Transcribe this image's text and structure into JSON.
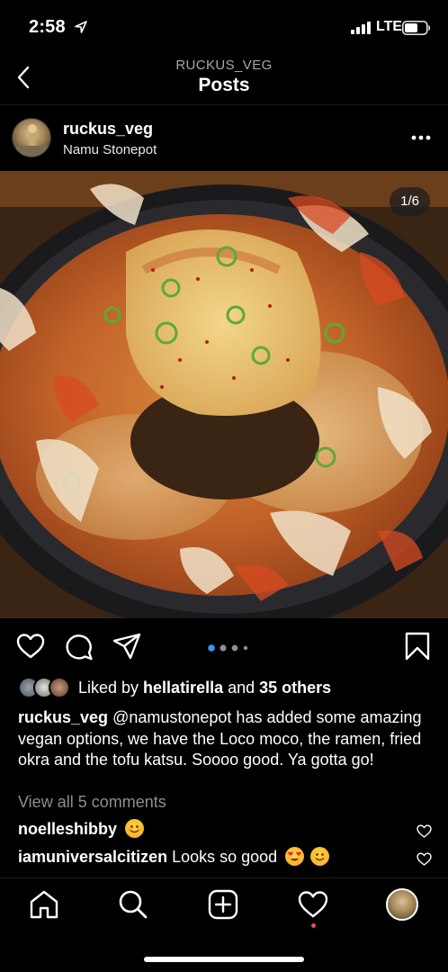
{
  "status_bar": {
    "time": "2:58",
    "network": "LTE"
  },
  "header": {
    "subtitle": "RUCKUS_VEG",
    "title": "Posts"
  },
  "post": {
    "username": "ruckus_veg",
    "location": "Namu Stonepot",
    "photo_counter": "1/6",
    "carousel": {
      "total_dots": 4,
      "active_index": 0
    },
    "likes": {
      "prefix": "Liked by ",
      "liker": "hellatirella",
      "joiner": " and ",
      "others": "35 others"
    },
    "caption": {
      "username": "ruckus_veg",
      "text": "@namustonepot has added some amazing vegan options, we have the Loco moco, the ramen, fried okra and the tofu katsu. Soooo good. Ya gotta go!"
    },
    "view_comments": "View all 5 comments",
    "comments": [
      {
        "username": "noelleshibby",
        "text": ""
      },
      {
        "username": "iamuniversalcitizen",
        "text": "Looks so good"
      }
    ]
  },
  "icons": {
    "back": "chevron-left-icon",
    "more": "more-horizontal-icon",
    "like": "heart-icon",
    "comment": "comment-icon",
    "share": "paper-plane-icon",
    "save": "bookmark-icon",
    "home": "home-icon",
    "search": "search-icon",
    "new_post": "plus-square-icon",
    "activity": "heart-icon"
  },
  "colors": {
    "background": "#000000",
    "carousel_active": "#3897f0",
    "notification": "#ed4956",
    "muted_text": "#8e8e8e"
  }
}
